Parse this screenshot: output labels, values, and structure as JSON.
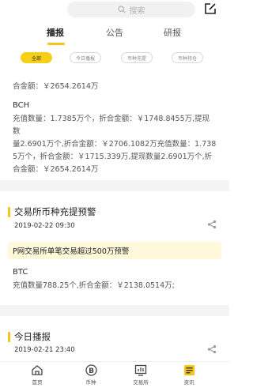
{
  "search": {
    "placeholder": "搜索"
  },
  "tabs": [
    {
      "label": "播报"
    },
    {
      "label": "公告"
    },
    {
      "label": "研报"
    }
  ],
  "filters": [
    {
      "label": "全部"
    },
    {
      "label": "今日播报"
    },
    {
      "label": "币种充提"
    },
    {
      "label": "币种持仓"
    }
  ],
  "feed": {
    "prev_total": "合金额：￥2654.2614万",
    "bch": {
      "coin": "BCH",
      "lines": [
        "充值数量：1.7385万个，折合金额：￥1748.8455万,提现数",
        "量2.6901万个,折合金额：￥2706.1082万充值数量：1.738",
        "5万个，折合金额：￥1715.339万,提现数量2.6901万个,折",
        "合金额：￥2654.2614万"
      ]
    },
    "section1": {
      "title": "交易所币种充提预警",
      "date": "2019-02-22 09:30",
      "alert": "P网交易所单笔交易超过500万预警",
      "coin": "BTC",
      "line": "充值数量788.25个,折合金额：￥2138.0514万;"
    },
    "section2": {
      "title": "今日播报",
      "date": "2019-02-21 23:40"
    }
  },
  "nav": [
    {
      "label": "首页"
    },
    {
      "label": "币种"
    },
    {
      "label": "交易所"
    },
    {
      "label": "资讯"
    }
  ],
  "colors": {
    "accent": "#f6c419",
    "alert_bg": "#fff8db"
  }
}
